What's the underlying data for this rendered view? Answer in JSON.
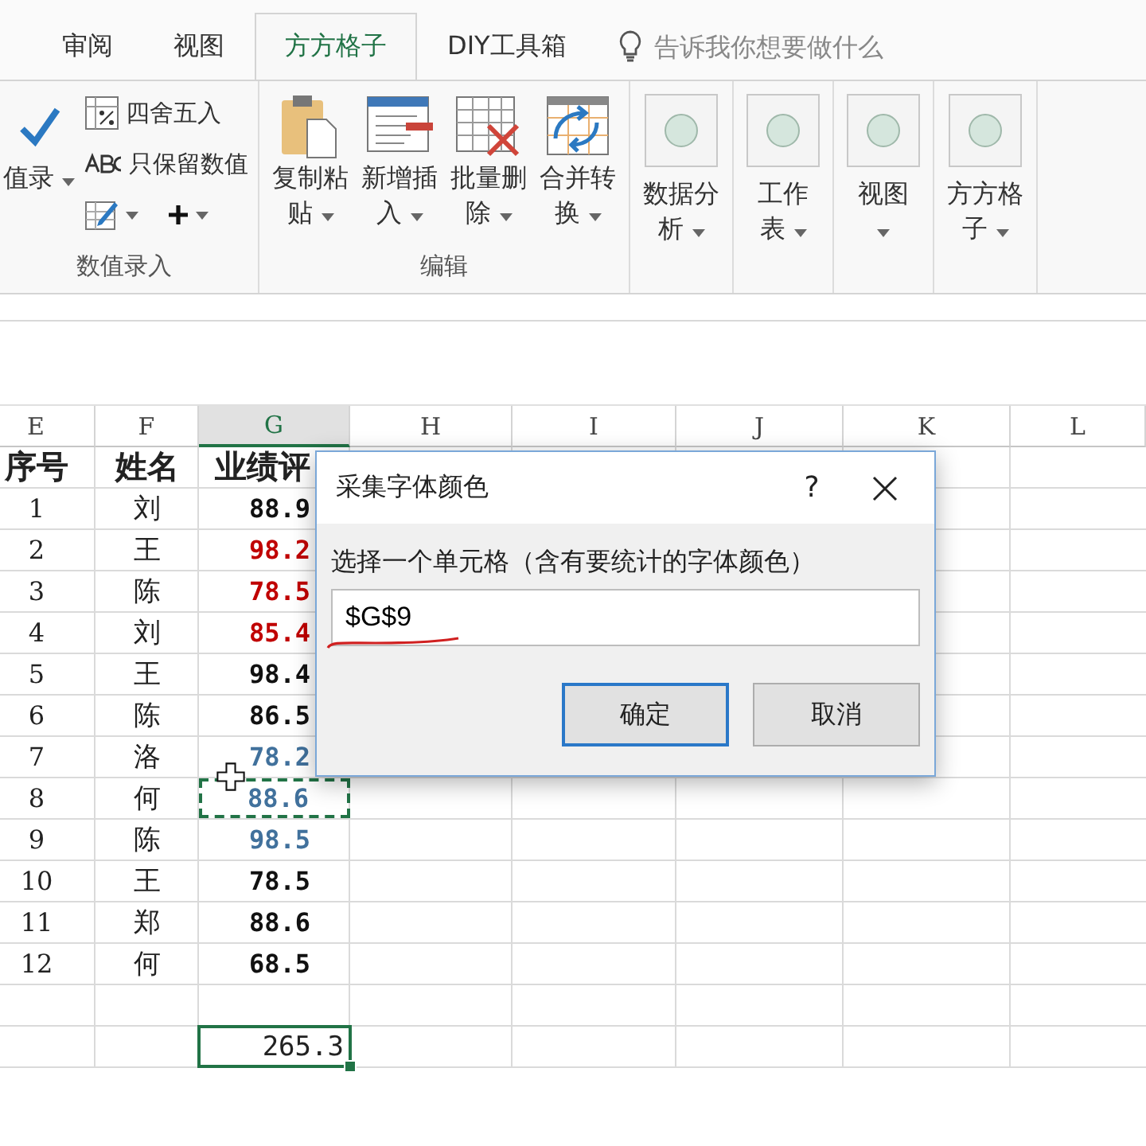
{
  "tabs": [
    {
      "label": "审阅",
      "selected": false
    },
    {
      "label": "视图",
      "selected": false
    },
    {
      "label": "方方格子",
      "selected": true
    },
    {
      "label": "DIY工具箱",
      "selected": false
    }
  ],
  "tell_me": {
    "placeholder": "告诉我你想要做什么"
  },
  "ribbon": {
    "groups": [
      {
        "label": "数值录入",
        "items": [
          {
            "kind": "large",
            "lines": [
              "值录"
            ]
          },
          {
            "kind": "small",
            "label": "四舍五入"
          },
          {
            "kind": "small",
            "label": "只保留数值"
          },
          {
            "kind": "icon_dropdown"
          },
          {
            "kind": "icon_dropdown"
          }
        ]
      },
      {
        "label": "编辑",
        "items": [
          {
            "kind": "large",
            "lines": [
              "复制粘",
              "贴"
            ]
          },
          {
            "kind": "large",
            "lines": [
              "新增插",
              "入"
            ]
          },
          {
            "kind": "large",
            "lines": [
              "批量删",
              "除"
            ]
          },
          {
            "kind": "large",
            "lines": [
              "合并转",
              "换"
            ]
          }
        ]
      },
      {
        "items": [
          {
            "kind": "circle",
            "lines": [
              "数据分",
              "析"
            ]
          }
        ]
      },
      {
        "items": [
          {
            "kind": "circle",
            "lines": [
              "工作",
              "表"
            ]
          }
        ]
      },
      {
        "items": [
          {
            "kind": "circle",
            "lines": [
              "视图"
            ]
          }
        ]
      },
      {
        "items": [
          {
            "kind": "circle",
            "lines": [
              "方方格",
              "子"
            ]
          }
        ]
      }
    ]
  },
  "sheet": {
    "columns": [
      {
        "label": "E",
        "selected": false
      },
      {
        "label": "F",
        "selected": false
      },
      {
        "label": "G",
        "selected": true
      },
      {
        "label": "H",
        "selected": false
      },
      {
        "label": "I",
        "selected": false
      },
      {
        "label": "J",
        "selected": false
      },
      {
        "label": "K",
        "selected": false
      },
      {
        "label": "L",
        "selected": false
      }
    ],
    "rows": [
      {
        "cells": [
          {
            "text": "序号",
            "kind": "header"
          },
          {
            "text": "姓名",
            "kind": "header"
          },
          {
            "text": "业绩评",
            "kind": "header"
          }
        ]
      },
      {
        "cells": [
          {
            "text": "1"
          },
          {
            "text": "刘"
          },
          {
            "text": "88.9",
            "kind": "score",
            "color": "#111111"
          }
        ]
      },
      {
        "cells": [
          {
            "text": "2"
          },
          {
            "text": "王"
          },
          {
            "text": "98.2",
            "kind": "score",
            "color": "#c00000"
          }
        ]
      },
      {
        "cells": [
          {
            "text": "3"
          },
          {
            "text": "陈"
          },
          {
            "text": "78.5",
            "kind": "score",
            "color": "#c00000"
          }
        ]
      },
      {
        "cells": [
          {
            "text": "4"
          },
          {
            "text": "刘"
          },
          {
            "text": "85.4",
            "kind": "score",
            "color": "#c00000"
          }
        ]
      },
      {
        "cells": [
          {
            "text": "5"
          },
          {
            "text": "王"
          },
          {
            "text": "98.4",
            "kind": "score",
            "color": "#111111"
          }
        ]
      },
      {
        "cells": [
          {
            "text": "6"
          },
          {
            "text": "陈"
          },
          {
            "text": "86.5",
            "kind": "score",
            "color": "#111111"
          }
        ]
      },
      {
        "cells": [
          {
            "text": "7"
          },
          {
            "text": "洛"
          },
          {
            "text": "78.2",
            "kind": "score",
            "color": "#41719c"
          }
        ]
      },
      {
        "cells": [
          {
            "text": "8"
          },
          {
            "text": "何"
          },
          {
            "text": "88.6",
            "kind": "score",
            "color": "#41719c",
            "marquee": true
          }
        ]
      },
      {
        "cells": [
          {
            "text": "9"
          },
          {
            "text": "陈"
          },
          {
            "text": "98.5",
            "kind": "score",
            "color": "#41719c"
          }
        ]
      },
      {
        "cells": [
          {
            "text": "10"
          },
          {
            "text": "王"
          },
          {
            "text": "78.5",
            "kind": "score",
            "color": "#111111"
          }
        ]
      },
      {
        "cells": [
          {
            "text": "11"
          },
          {
            "text": "郑"
          },
          {
            "text": "88.6",
            "kind": "score",
            "color": "#111111"
          }
        ]
      },
      {
        "cells": [
          {
            "text": "12"
          },
          {
            "text": "何"
          },
          {
            "text": "68.5",
            "kind": "score",
            "color": "#111111"
          }
        ]
      }
    ],
    "total": {
      "text": "265.3",
      "selected": true
    }
  },
  "dialog": {
    "title": "采集字体颜色",
    "help": "?",
    "prompt": "选择一个单元格（含有要统计的字体颜色）",
    "value": "$G$9",
    "buttons": [
      {
        "label": "确定",
        "default": true
      },
      {
        "label": "取消",
        "default": false
      }
    ]
  }
}
